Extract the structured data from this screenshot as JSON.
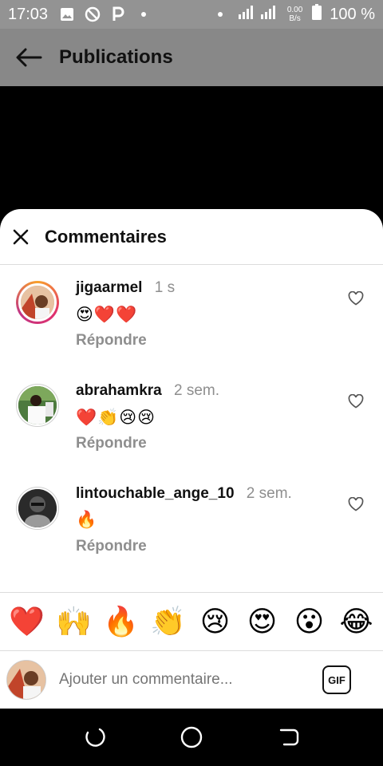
{
  "status": {
    "time": "17:03",
    "speed_value": "0.00",
    "speed_unit": "B/s",
    "battery": "100 %"
  },
  "header": {
    "title": "Publications"
  },
  "sheet": {
    "title": "Commentaires"
  },
  "comments": [
    {
      "username": "jigaarmel",
      "time": "1 s",
      "text": "😍❤️❤️",
      "reply": "Répondre",
      "avatar": "story"
    },
    {
      "username": "abrahamkra",
      "time": "2 sem.",
      "text": "❤️👏😢😢",
      "reply": "Répondre",
      "avatar": "plain"
    },
    {
      "username": "lintouchable_ange_10",
      "time": "2 sem.",
      "text": "🔥",
      "reply": "Répondre",
      "avatar": "plain"
    }
  ],
  "emoji_bar": [
    "❤️",
    "🙌",
    "🔥",
    "👏",
    "😢",
    "😍",
    "😮",
    "😂"
  ],
  "composer": {
    "placeholder": "Ajouter un commentaire...",
    "gif_label": "GIF"
  },
  "colors": {
    "accent_gradient_start": "#f9a12b",
    "accent_gradient_end": "#c13584",
    "muted_text": "#8e8e8e"
  }
}
